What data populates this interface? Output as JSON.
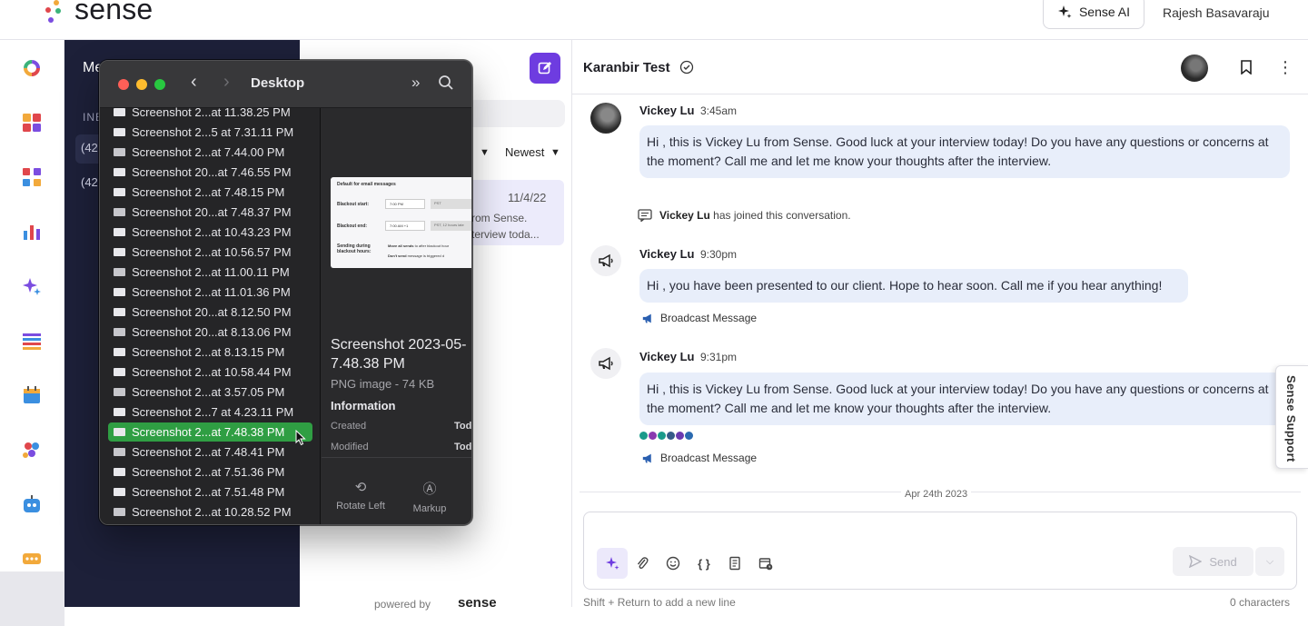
{
  "app": {
    "brand": "sense",
    "sense_ai_label": "Sense AI",
    "user_name": "Rajesh Basavaraju"
  },
  "side_panel": {
    "title": "Me",
    "inbox_label": "INB",
    "items": [
      {
        "label": "(42"
      },
      {
        "label": "(42"
      }
    ]
  },
  "list": {
    "sort_label": "Newest",
    "card": {
      "date": "11/4/22",
      "preview_line1": "rom Sense.",
      "preview_line2": "terview toda..."
    },
    "powered_by": "powered by",
    "powered_brand": "sense"
  },
  "chat": {
    "contact_name": "Karanbir Test",
    "messages": [
      {
        "sender": "Vickey Lu",
        "time": "3:45am",
        "text": "Hi , this is Vickey Lu from Sense. Good luck at your interview today! Do you have any questions or concerns at the moment? Call me and let me know your thoughts after the interview."
      },
      {
        "sender": "Vickey Lu",
        "time": "9:30pm",
        "text": "Hi , you have been presented to our client. Hope to hear soon. Call me if you hear anything!",
        "tag": "Broadcast Message"
      },
      {
        "sender": "Vickey Lu",
        "time": "9:31pm",
        "text": "Hi , this is Vickey Lu from Sense. Good luck at your interview today! Do you have any questions or concerns at the moment? Call me and let me know your thoughts after the interview.",
        "tag": "Broadcast Message"
      }
    ],
    "joined": {
      "name": "Vickey Lu",
      "text": "has joined this conversation."
    },
    "date_divider": "Apr 24th 2023",
    "send_label": "Send",
    "hint": "Shift + Return to add a new line",
    "char_count": "0 characters",
    "support_label": "Sense Support",
    "read_dot_colors": [
      "#1a9a8a",
      "#8a3ab0",
      "#1a9a8a",
      "#355a88",
      "#6a3ab0",
      "#2a6ab0"
    ]
  },
  "finder": {
    "title": "Desktop",
    "files": [
      {
        "name": "Screenshot 2...at 11.38.25 PM",
        "icon": "image-icon"
      },
      {
        "name": "Screenshot 2...5 at 7.31.11 PM",
        "icon": "image-icon"
      },
      {
        "name": "Screenshot 2...at 7.44.00 PM",
        "icon": "image-icon"
      },
      {
        "name": "Screenshot 20...at 7.46.55 PM",
        "icon": "image-icon"
      },
      {
        "name": "Screenshot 2...at 7.48.15 PM",
        "icon": "image-icon"
      },
      {
        "name": "Screenshot 20...at 7.48.37 PM",
        "icon": "image-icon"
      },
      {
        "name": "Screenshot 2...at 10.43.23 PM",
        "icon": "image-icon"
      },
      {
        "name": "Screenshot 2...at 10.56.57 PM",
        "icon": "image-icon"
      },
      {
        "name": "Screenshot 2...at 11.00.11 PM",
        "icon": "image-icon"
      },
      {
        "name": "Screenshot 2...at 11.01.36 PM",
        "icon": "image-icon"
      },
      {
        "name": "Screenshot 20...at 8.12.50 PM",
        "icon": "image-icon"
      },
      {
        "name": "Screenshot 20...at 8.13.06 PM",
        "icon": "image-icon"
      },
      {
        "name": "Screenshot 2...at 8.13.15 PM",
        "icon": "image-icon"
      },
      {
        "name": "Screenshot 2...at 10.58.44 PM",
        "icon": "image-icon"
      },
      {
        "name": "Screenshot 2...at 3.57.05 PM",
        "icon": "image-icon"
      },
      {
        "name": "Screenshot 2...7 at 4.23.11 PM",
        "icon": "image-icon"
      },
      {
        "name": "Screenshot 2...at 7.48.38 PM",
        "icon": "image-icon",
        "selected": true
      },
      {
        "name": "Screenshot 2...at 7.48.41 PM",
        "icon": "image-icon"
      },
      {
        "name": "Screenshot 2...at 7.51.36 PM",
        "icon": "image-icon"
      },
      {
        "name": "Screenshot 2...at 7.51.48 PM",
        "icon": "image-icon"
      },
      {
        "name": "Screenshot 2...at 10.28.52 PM",
        "icon": "image-icon"
      }
    ],
    "preview": {
      "name_line1": "Screenshot 2023-05-",
      "name_line2": "7.48.38 PM",
      "kind": "PNG image - 74 KB",
      "info_heading": "Information",
      "created_label": "Created",
      "created_value": "Tod",
      "modified_label": "Modified",
      "modified_value": "Tod",
      "action_rotate": "Rotate Left",
      "action_markup": "Markup",
      "thumb_heading": "Default for email messages",
      "thumb_row1": "Blackout start:",
      "thumb_row2": "Blackout end:",
      "thumb_row3": "Sending during blackout hours:",
      "thumb_val1": "7:00 PM",
      "thumb_val2": "7:00 AM +1",
      "thumb_tz1": "PST",
      "thumb_tz2": "PST, 12 hours late",
      "thumb_opt1": "Move all sends",
      "thumb_opt1_rest": "to after blackout hour",
      "thumb_opt2": "Don't send",
      "thumb_opt2_rest": "message is triggered d"
    }
  }
}
